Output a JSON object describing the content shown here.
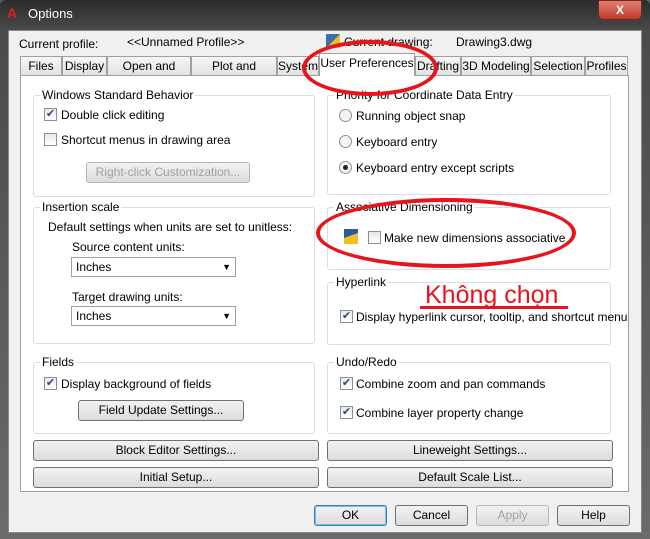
{
  "window": {
    "title": "Options",
    "close": "X"
  },
  "header": {
    "current_profile_label": "Current profile:",
    "current_profile": "<<Unnamed Profile>>",
    "current_drawing_label": "Current drawing:",
    "current_drawing": "Drawing3.dwg"
  },
  "tabs": [
    "Files",
    "Display",
    "Open and Save",
    "Plot and Publish",
    "System",
    "User Preferences",
    "Drafting",
    "3D Modeling",
    "Selection",
    "Profiles"
  ],
  "windows_behavior": {
    "title": "Windows Standard Behavior",
    "double_click": "Double click editing",
    "shortcut_menus": "Shortcut menus in drawing area",
    "right_click_button": "Right-click Customization..."
  },
  "insertion_scale": {
    "title": "Insertion scale",
    "desc": "Default settings when units are set to unitless:",
    "source_label": "Source content units:",
    "source_value": "Inches",
    "target_label": "Target drawing units:",
    "target_value": "Inches"
  },
  "fields": {
    "title": "Fields",
    "display_bg": "Display background of fields",
    "update_button": "Field Update Settings..."
  },
  "priority": {
    "title": "Priority for Coordinate Data Entry",
    "options": [
      "Running object snap",
      "Keyboard entry",
      "Keyboard entry except scripts"
    ],
    "selected": 2
  },
  "assoc_dim": {
    "title": "Associative Dimensioning",
    "make_assoc": "Make new dimensions associative",
    "checked": false
  },
  "annotation": {
    "text": "Không chọn",
    "color": "#e8141c"
  },
  "hyperlink": {
    "title": "Hyperlink",
    "display": "Display hyperlink cursor, tooltip, and shortcut menu"
  },
  "undo_redo": {
    "title": "Undo/Redo",
    "combine_zoom": "Combine zoom and pan commands",
    "combine_layer": "Combine layer property change"
  },
  "panel_buttons": {
    "block_editor": "Block Editor Settings...",
    "lineweight": "Lineweight Settings...",
    "initial_setup": "Initial Setup...",
    "default_scale": "Default Scale List..."
  },
  "footer": {
    "ok": "OK",
    "cancel": "Cancel",
    "apply": "Apply",
    "help": "Help"
  }
}
